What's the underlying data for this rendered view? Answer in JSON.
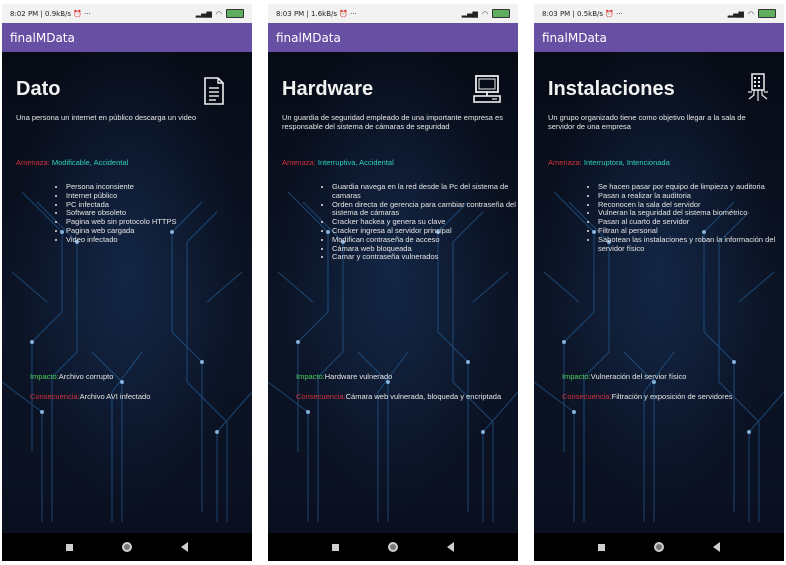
{
  "screens": [
    {
      "status_left": "8:02 PM | 0.9kB/s ⏰ ···",
      "app_title": "finalMData",
      "title": "Dato",
      "icon": "document-icon",
      "description": "Una persona un internet en público descarga un video",
      "threat_label": "Amenaza:",
      "threat_value": "Modificable, Accidental",
      "items": [
        "Persona inconsiente",
        "Internet público",
        "PC infectada",
        "Software obsoleto",
        "Pagina web sin protocolo HTTPS",
        "Pagina web cargada",
        "Video infectado"
      ],
      "impact_label": "Impacto:",
      "impact_value": "Archivo corrupto",
      "consequence_label": "Consecuencia:",
      "consequence_value": "Archivo AVI infectado"
    },
    {
      "status_left": "8:03 PM | 1.6kB/s ⏰ ···",
      "app_title": "finalMData",
      "title": "Hardware",
      "icon": "computer-icon",
      "description": "Un guardia de seguridad empleado de una importante empresa es responsable del sistema de cámaras de seguridad",
      "threat_label": "Amenaza:",
      "threat_value": "Interruptiva, Accidental",
      "items": [
        "Guardia navega en la red desde la Pc del sistema de camaras",
        "Orden directa de gerencia para cambiar contraseña del sistema de cámaras",
        "Cracker hackea y genera su clave",
        "Cracker ingresa al servidor principal",
        "Modifican contraseña de acceso",
        "Cámara web bloqueada",
        "Camar y contraseña vulnerados"
      ],
      "impact_label": "Impacto:",
      "impact_value": "Hardware vulnerado",
      "consequence_label": "Consecuencia:",
      "consequence_value": "Cámara web vulnerada, bloqueda y encriptada"
    },
    {
      "status_left": "8:03 PM | 0.5kB/s ⏰ ···",
      "app_title": "finalMData",
      "title": "Instalaciones",
      "icon": "building-circuit-icon",
      "description": "Un grupo organizado tiene como objetivo llegar a la sala de servidor de una empresa",
      "threat_label": "Amenaza:",
      "threat_value": "Interruptora, Intencionada",
      "items": [
        "Se hacen pasar por equipo de limpieza y auditoria",
        "Pasan a realizar la auditoria",
        "Reconocen la sala del servidor",
        "Vulneran la seguridad del sistema biométrico",
        "Pasan al cuarto de servidor",
        "Filtran al personal",
        "Sabotean las instalaciones y roban la información del servidor físico"
      ],
      "impact_label": "Impacto:",
      "impact_value": "Vulneración del servior físico",
      "consequence_label": "Consecuencia:",
      "consequence_value": "Filtración y exposición de servidores"
    }
  ],
  "colors": {
    "appbar": "#6750a4",
    "threat_label": "#d4323a",
    "threat_value": "#2fd3c0",
    "impact_label": "#4ecf5a",
    "consequence_label": "#d4323a"
  }
}
